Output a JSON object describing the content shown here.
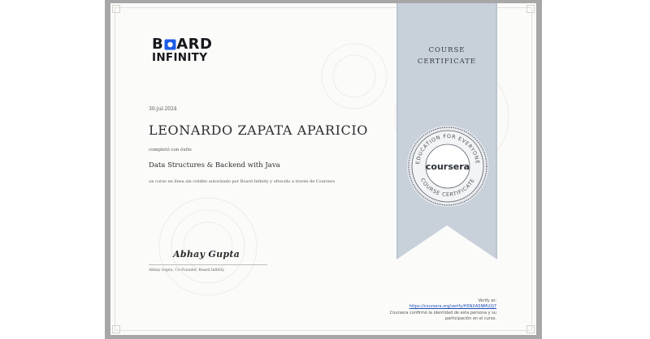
{
  "logo": {
    "line1_left": "B",
    "line1_right": "ARD",
    "line2": "INFINITY"
  },
  "certificate": {
    "date": "30-jul-2024",
    "recipient_name": "LEONARDO ZAPATA APARICIO",
    "completed_text": "completó con éxito",
    "course_title": "Data Structures & Backend with Java",
    "description": "un curso en línea sin crédito autorizado por Board Infinity y ofrecido a través de Coursera"
  },
  "signatory": {
    "signature": "Abhay Gupta",
    "caption": "Abhay Gupta, Co-Founder, Board Infinity"
  },
  "ribbon": {
    "title_line1": "COURSE",
    "title_line2": "CERTIFICATE"
  },
  "seal": {
    "brand": "coursera",
    "ring_top": "EDUCATION FOR EVERYONE",
    "ring_bottom": "COURSE CERTIFICATE"
  },
  "verify": {
    "label": "Verify at:",
    "url": "https://coursera.org/verify/H5NXASNMU2J7",
    "confirmation_line1": "Coursera confirmó la identidad de esta persona y su",
    "confirmation_line2": "participación en el curso."
  },
  "colors": {
    "ribbon": "#c8d0da",
    "ribbon_edge": "#b6c0cc",
    "frame": "#a7a7a7",
    "link": "#1f4fb8",
    "seal": "#5c636d"
  },
  "icons": [
    "coursera-seal-icon",
    "board-infinity-logo-icon"
  ]
}
